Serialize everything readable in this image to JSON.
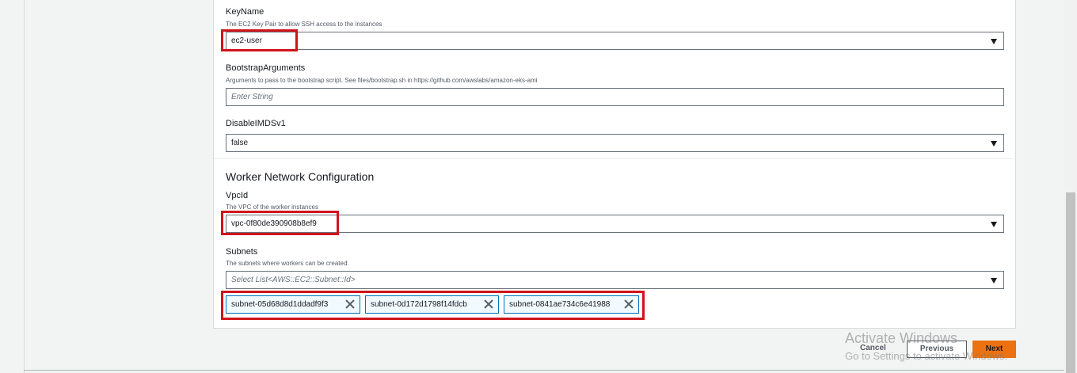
{
  "fields": {
    "key_name": {
      "label": "KeyName",
      "description": "The EC2 Key Pair to allow SSH access to the instances",
      "value": "ec2-user"
    },
    "bootstrap_arguments": {
      "label": "BootstrapArguments",
      "description": "Arguments to pass to the bootstrap script. See files/bootstrap.sh in https://github.com/awslabs/amazon-eks-ami",
      "placeholder": "Enter String"
    },
    "disable_imdsv1": {
      "label": "DisableIMDSv1",
      "value": "false"
    }
  },
  "worker_network": {
    "title": "Worker Network Configuration",
    "vpc_id": {
      "label": "VpcId",
      "description": "The VPC of the worker instances",
      "value": "vpc-0f80de390908b8ef9"
    },
    "subnets": {
      "label": "Subnets",
      "description": "The subnets where workers can be created.",
      "placeholder": "Select List<AWS::EC2::Subnet::Id>",
      "selected": [
        "subnet-05d68d8d1ddadf9f3",
        "subnet-0d172d1798f14fdcb",
        "subnet-0841ae734c6e41988"
      ]
    }
  },
  "footer": {
    "cancel_label": "Cancel",
    "previous_label": "Previous",
    "next_label": "Next"
  },
  "watermark": {
    "line1": "Activate Windows",
    "line2": "Go to Settings to activate Windows."
  },
  "colors": {
    "accent": "#ec7211",
    "highlight": "#d0141c",
    "chip_border": "#0073bb"
  }
}
